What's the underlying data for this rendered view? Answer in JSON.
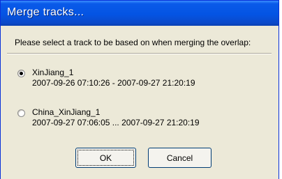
{
  "window": {
    "title": "Merge tracks..."
  },
  "prompt": "Please select a track to be based on when merging the overlap:",
  "options": [
    {
      "name": "XinJiang_1",
      "range": "2007-09-26 07:10:26  -  2007-09-27 21:20:19",
      "selected": true
    },
    {
      "name": "China_XinJiang_1",
      "range": "2007-09-27 07:06:05  ...  2007-09-27 21:20:19",
      "selected": false
    }
  ],
  "buttons": {
    "ok_label": "OK",
    "cancel_label": "Cancel"
  },
  "colors": {
    "titlebar": "#0454e3",
    "dialog_background": "#ece9d8",
    "button_border": "#003c74"
  }
}
